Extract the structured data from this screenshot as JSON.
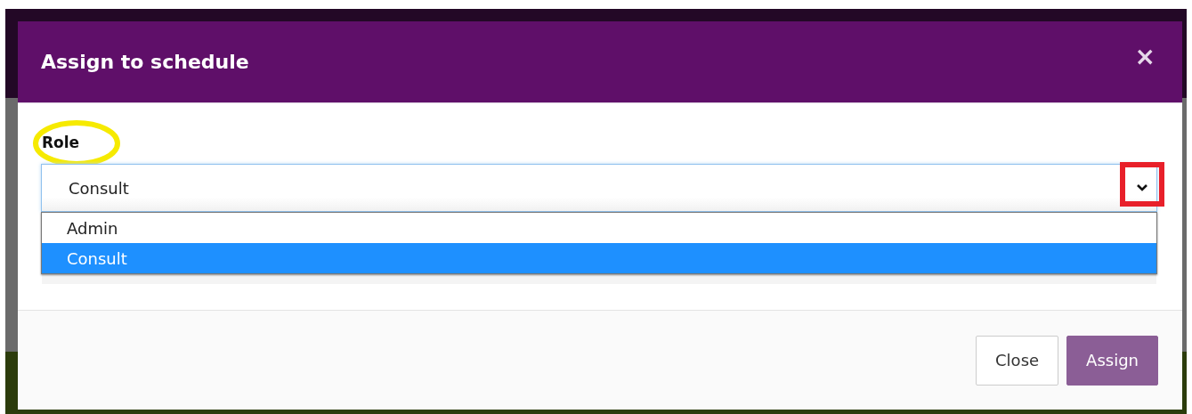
{
  "dialog": {
    "title": "Assign to schedule",
    "close": "×"
  },
  "field": {
    "label": "Role",
    "value": "Consult",
    "expanded": true,
    "options": [
      {
        "label": "Admin",
        "selected": false
      },
      {
        "label": "Consult",
        "selected": true
      }
    ]
  },
  "annotations": [
    {
      "kind": "ellipse"
    },
    {
      "kind": "rectangle"
    }
  ],
  "buttons": [
    {
      "label": "Close",
      "kind": "default"
    },
    {
      "label": "Assign",
      "kind": "primary"
    }
  ]
}
